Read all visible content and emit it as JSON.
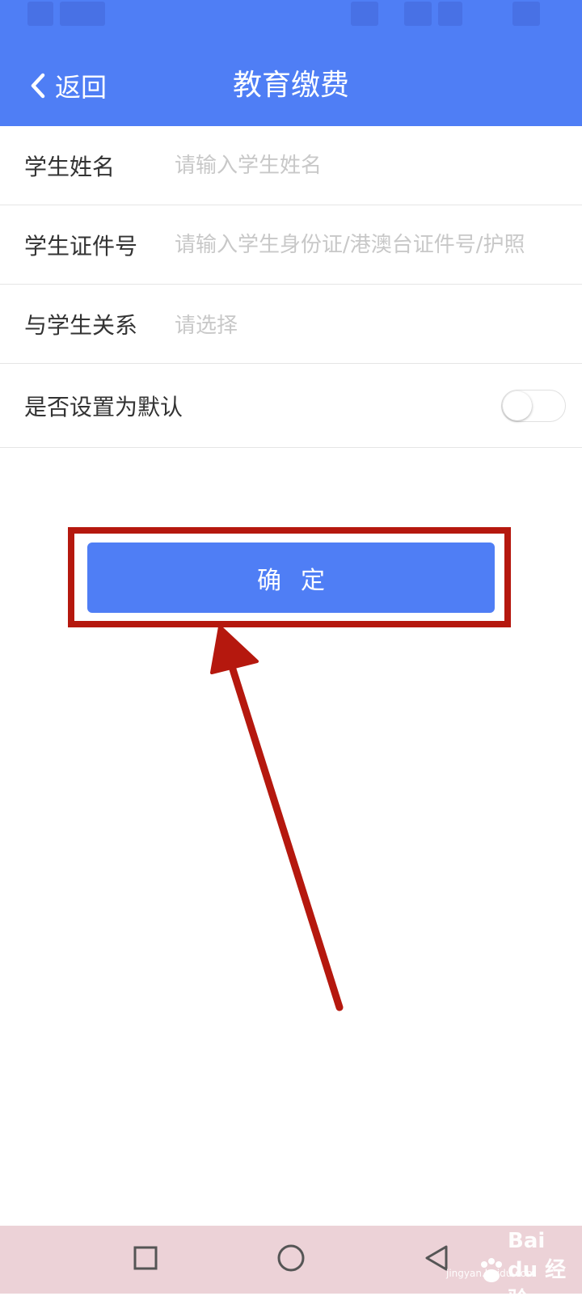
{
  "header": {
    "back_label": "返回",
    "title": "教育缴费",
    "background_color": "#4f7ef5"
  },
  "form": {
    "student_name": {
      "label": "学生姓名",
      "placeholder": "请输入学生姓名",
      "value": ""
    },
    "student_id": {
      "label": "学生证件号",
      "placeholder": "请输入学生身份证/港澳台证件号/护照",
      "value": ""
    },
    "relation": {
      "label": "与学生关系",
      "placeholder": "请选择"
    },
    "set_default": {
      "label": "是否设置为默认",
      "on": false
    }
  },
  "confirm_button": {
    "label": "确定",
    "color": "#4f7ef5"
  },
  "annotation": {
    "highlight_color": "#b5180e",
    "arrow_color": "#b5180e"
  },
  "nav": {
    "icons": [
      "square-recent-icon",
      "circle-home-icon",
      "triangle-back-icon"
    ],
    "background_color": "#ecd2d7"
  },
  "watermark": {
    "logo_text": "Bai du 经验",
    "sub_text": "jingyan.baidu.com"
  }
}
